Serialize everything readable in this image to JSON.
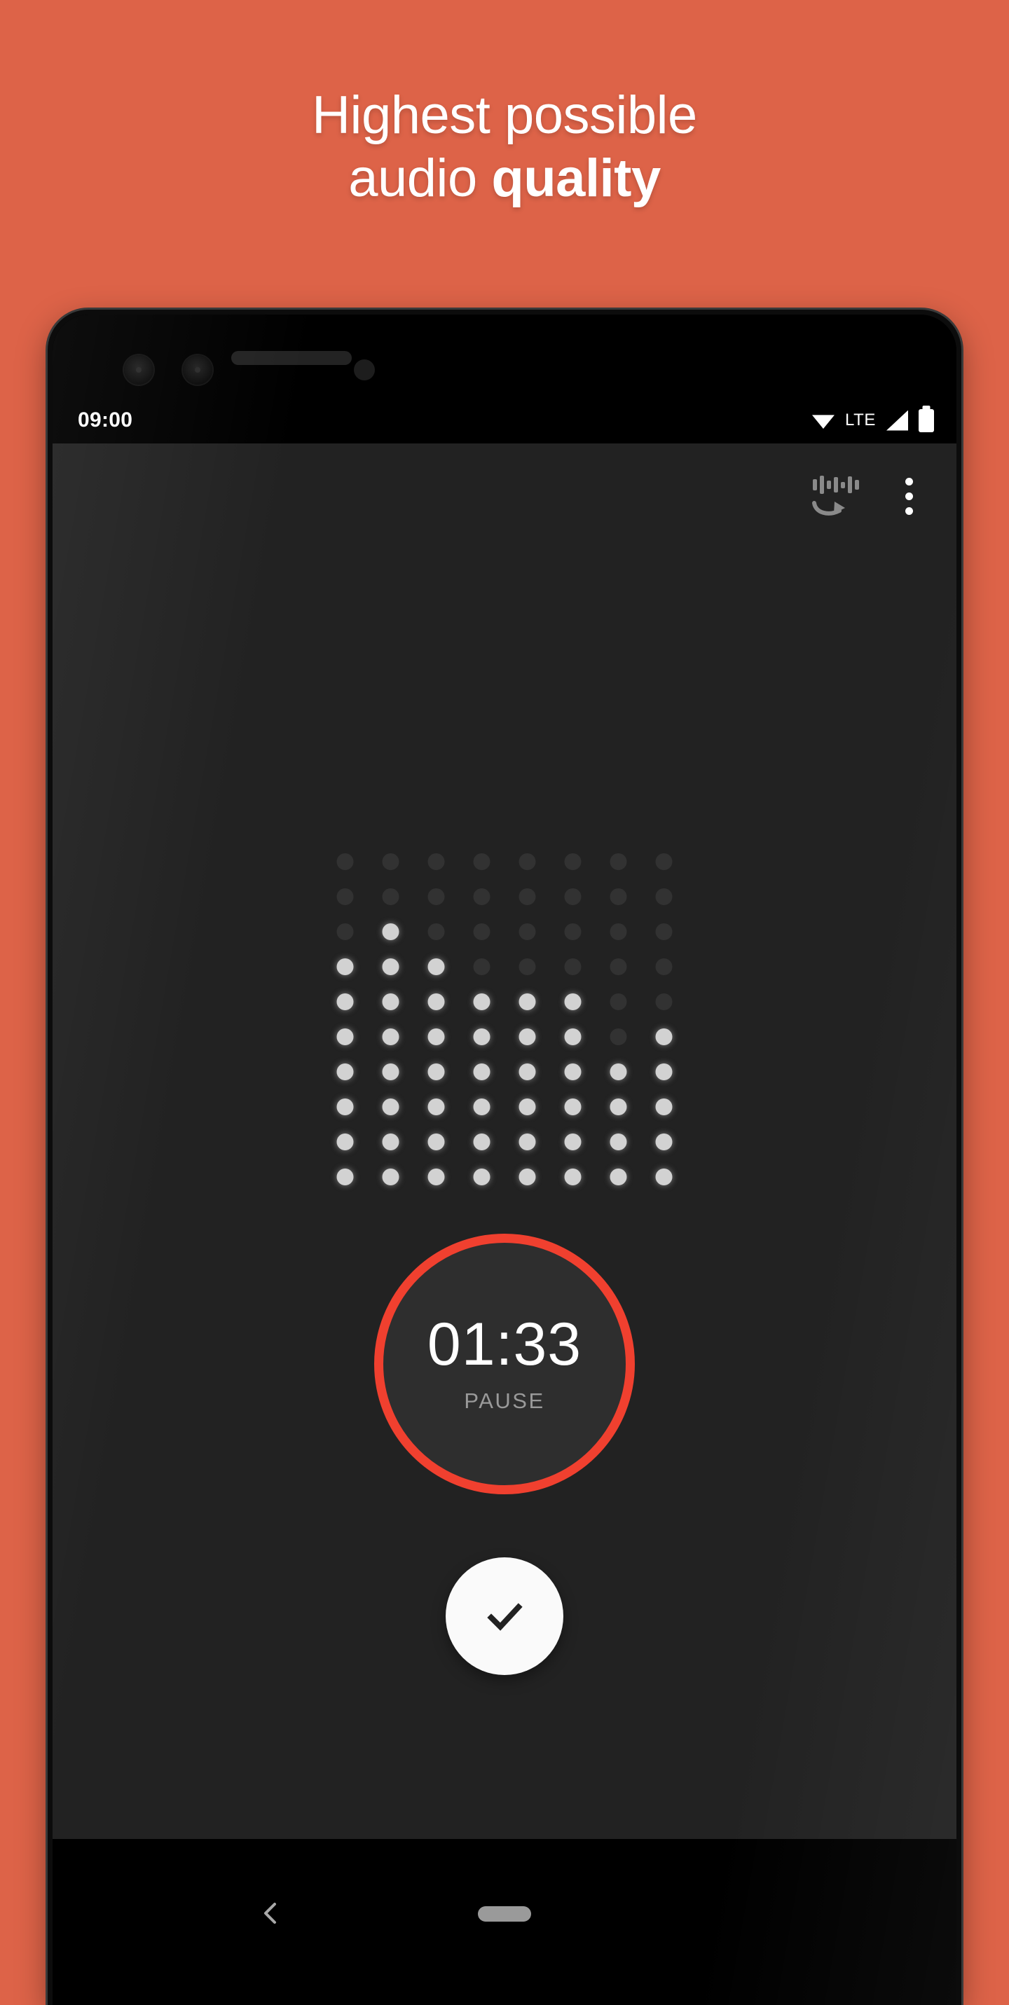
{
  "promo": {
    "background_color": "#dd6348",
    "headline_line1": "Highest possible",
    "headline_line2_normal": "audio ",
    "headline_line2_bold": "quality"
  },
  "status_bar": {
    "clock": "09:00",
    "network_label": "LTE",
    "icons": [
      "wifi-icon",
      "signal-icon",
      "battery-icon"
    ]
  },
  "app_bar": {
    "waveform_restore_icon": "waveform-restore-icon",
    "overflow_menu_icon": "overflow-menu-icon"
  },
  "visualizer": {
    "type": "dot-matrix",
    "columns": 8,
    "rows": 10,
    "off_color": "#323232",
    "on_color": "#d2d2d2",
    "levels": [
      7,
      8,
      7,
      6,
      6,
      6,
      4,
      5
    ]
  },
  "recorder": {
    "elapsed_time": "01:33",
    "action_label": "PAUSE",
    "ring_color": "#f0402f",
    "confirm_icon": "check-icon"
  },
  "nav_bar": {
    "back_icon": "back-chevron-icon",
    "home_icon": "home-pill-icon"
  }
}
